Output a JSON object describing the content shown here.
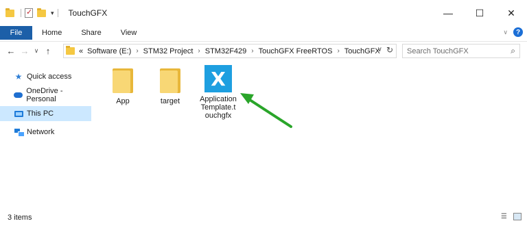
{
  "window": {
    "title": "TouchGFX",
    "minimize_glyph": "—",
    "maximize_glyph": "☐",
    "close_glyph": "✕"
  },
  "ribbon": {
    "tabs": [
      "File",
      "Home",
      "Share",
      "View"
    ],
    "help_glyph": "?",
    "collapse_glyph": "∨"
  },
  "nav_buttons": {
    "back": "←",
    "forward": "→",
    "recent": "∨",
    "up": "↑"
  },
  "address": {
    "overflow": "«",
    "crumbs": [
      "Software (E:)",
      "STM32 Project",
      "STM32F429",
      "TouchGFX FreeRTOS",
      "TouchGFX"
    ],
    "separator": "›",
    "dropdown_glyph": "∨",
    "refresh_glyph": "↻"
  },
  "search": {
    "placeholder": "Search TouchGFX"
  },
  "navpane": {
    "items": [
      {
        "label": "Quick access"
      },
      {
        "label": "OneDrive - Personal"
      },
      {
        "label": "This PC"
      },
      {
        "label": "Network"
      }
    ]
  },
  "files": [
    {
      "name": "App",
      "type": "folder"
    },
    {
      "name": "target",
      "type": "folder"
    },
    {
      "name_lines": [
        "Application",
        "Template.t",
        "ouchgfx"
      ],
      "type": "touchgfx"
    }
  ],
  "annotation": {
    "color": "#2aa52a"
  },
  "status": {
    "item_count": "3 items"
  },
  "icons": {
    "search": "search-icon",
    "quick_access": "star-icon",
    "onedrive": "cloud-icon",
    "this_pc": "computer-icon",
    "network": "network-icon"
  }
}
